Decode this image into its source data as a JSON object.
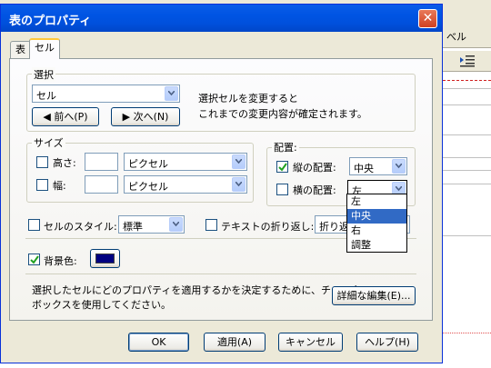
{
  "background_app": {
    "toolbar_label": "べル"
  },
  "dialog": {
    "title": "表のプロパティ",
    "close_glyph": "✕",
    "tabs": [
      {
        "label": "表"
      },
      {
        "label": "セル"
      }
    ],
    "selection": {
      "legend": "選択",
      "value": "セル",
      "prev_label": "前へ(P)",
      "next_label": "次へ(N)",
      "hint_line1": "選択セルを変更すると",
      "hint_line2": "これまでの変更内容が確定されます。"
    },
    "size": {
      "legend": "サイズ",
      "height_label": "高さ:",
      "height_unit": "ピクセル",
      "width_label": "幅:",
      "width_unit": "ピクセル"
    },
    "alignment": {
      "legend": "配置:",
      "vertical_label": "縦の配置:",
      "vertical_value": "中央",
      "horizontal_label": "横の配置:",
      "horizontal_value": "左",
      "options": [
        "左",
        "中央",
        "右",
        "調整"
      ],
      "highlighted": "中央"
    },
    "cell_style": {
      "label": "セルのスタイル:",
      "value": "標準"
    },
    "text_wrap": {
      "label": "テキストの折り返し:",
      "value": "折り返し"
    },
    "background": {
      "label": "背景色:",
      "color": "#000080",
      "checked": true
    },
    "footer_note_line1": "選択したセルにどのプロパティを適用するかを決定するために、チェック",
    "footer_note_line2": "ボックスを使用してください。",
    "advanced_button": "詳細な編集(E)...",
    "buttons": {
      "ok": "OK",
      "apply": "適用(A)",
      "cancel": "キャンセル",
      "help": "ヘルプ(H)"
    }
  }
}
